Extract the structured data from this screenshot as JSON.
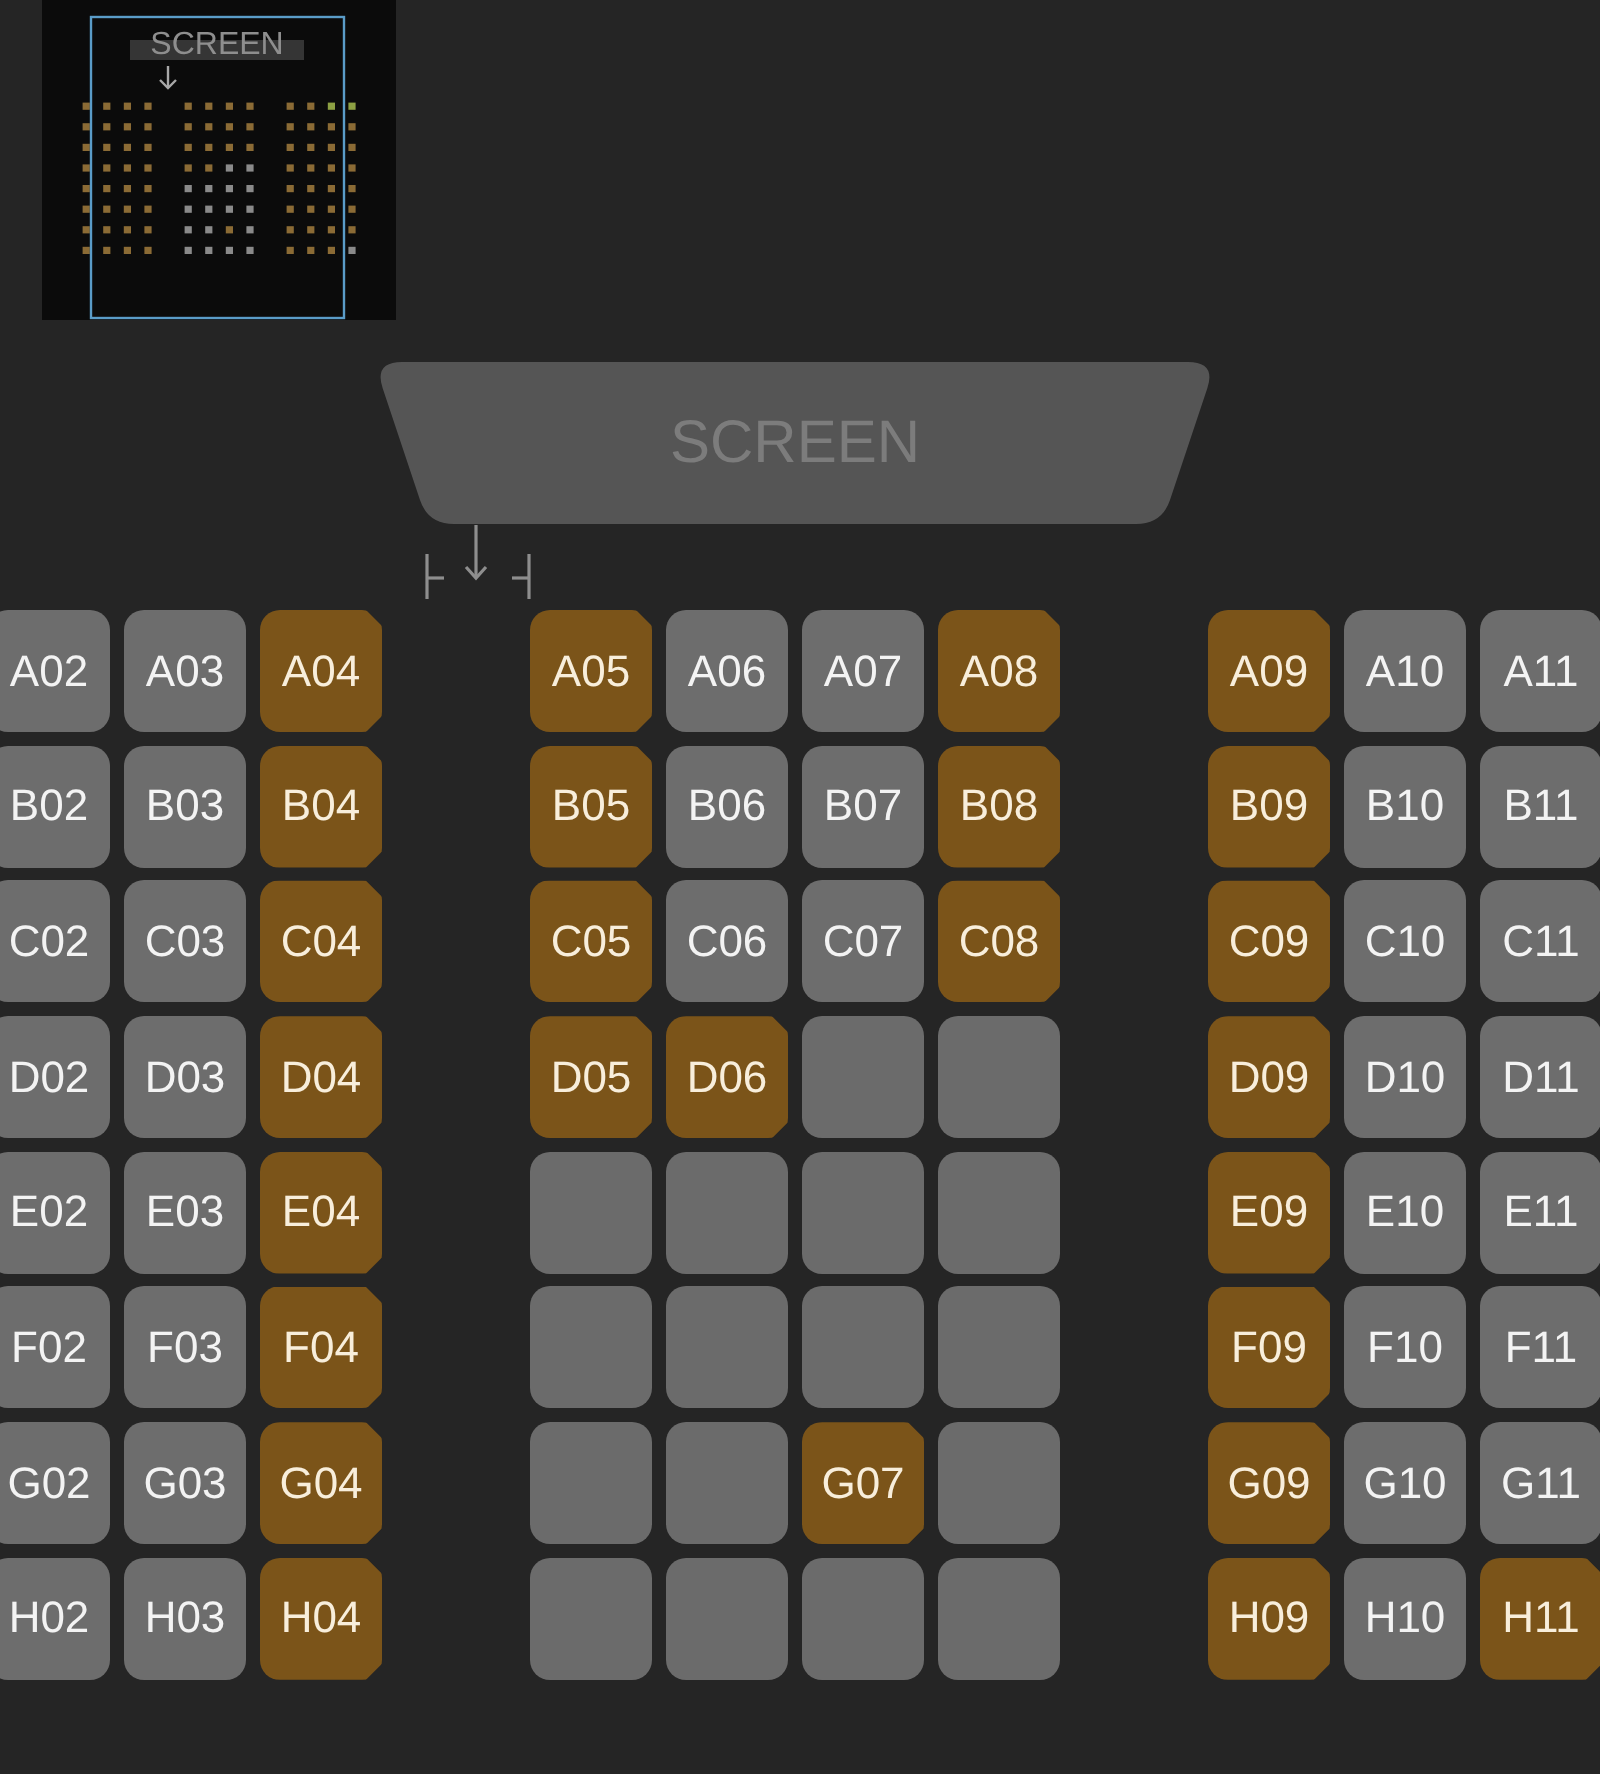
{
  "minimap": {
    "screen_label": "SCREEN",
    "sections": [
      {
        "rows": [
          {
            "dots": [
              {
                "color": "#8b6b35"
              },
              {
                "color": "#8b6b35"
              },
              {
                "color": "#8b6b35"
              },
              {
                "color": "#8b6b35"
              }
            ]
          },
          {
            "dots": [
              {
                "color": "#8b6b35"
              },
              {
                "color": "#8b6b35"
              },
              {
                "color": "#8b6b35"
              },
              {
                "color": "#8b6b35"
              }
            ]
          },
          {
            "dots": [
              {
                "color": "#8b6b35"
              },
              {
                "color": "#8b6b35"
              },
              {
                "color": "#8b6b35"
              },
              {
                "color": "#8b6b35"
              }
            ]
          },
          {
            "dots": [
              {
                "color": "#8b6b35"
              },
              {
                "color": "#8b6b35"
              },
              {
                "color": "#8b6b35"
              },
              {
                "color": "#8b6b35"
              }
            ]
          },
          {
            "dots": [
              {
                "color": "#8b6b35"
              },
              {
                "color": "#8b6b35"
              },
              {
                "color": "#8b6b35"
              },
              {
                "color": "#8b6b35"
              }
            ]
          },
          {
            "dots": [
              {
                "color": "#8b6b35"
              },
              {
                "color": "#8b6b35"
              },
              {
                "color": "#8b6b35"
              },
              {
                "color": "#8b6b35"
              }
            ]
          },
          {
            "dots": [
              {
                "color": "#8b6b35"
              },
              {
                "color": "#8b6b35"
              },
              {
                "color": "#8b6b35"
              },
              {
                "color": "#8b6b35"
              }
            ]
          },
          {
            "dots": [
              {
                "color": "#8b6b35"
              },
              {
                "color": "#8b6b35"
              },
              {
                "color": "#8b6b35"
              },
              {
                "color": "#8b6b35"
              }
            ]
          }
        ]
      },
      {
        "rows": [
          {
            "dots": [
              {
                "color": "#8b6b35"
              },
              {
                "color": "#8b6b35"
              },
              {
                "color": "#8b6b35"
              },
              {
                "color": "#8b6b35"
              }
            ]
          },
          {
            "dots": [
              {
                "color": "#8b6b35"
              },
              {
                "color": "#8b6b35"
              },
              {
                "color": "#8b6b35"
              },
              {
                "color": "#8b6b35"
              }
            ]
          },
          {
            "dots": [
              {
                "color": "#8b6b35"
              },
              {
                "color": "#8b6b35"
              },
              {
                "color": "#8b6b35"
              },
              {
                "color": "#8b6b35"
              }
            ]
          },
          {
            "dots": [
              {
                "color": "#8b6b35"
              },
              {
                "color": "#8b6b35"
              },
              {
                "color": "#8a8a8a"
              },
              {
                "color": "#8a8a8a"
              }
            ]
          },
          {
            "dots": [
              {
                "color": "#8a8a8a"
              },
              {
                "color": "#8a8a8a"
              },
              {
                "color": "#8a8a8a"
              },
              {
                "color": "#8a8a8a"
              }
            ]
          },
          {
            "dots": [
              {
                "color": "#8a8a8a"
              },
              {
                "color": "#8a8a8a"
              },
              {
                "color": "#8a8a8a"
              },
              {
                "color": "#8a8a8a"
              }
            ]
          },
          {
            "dots": [
              {
                "color": "#8a8a8a"
              },
              {
                "color": "#8a8a8a"
              },
              {
                "color": "#8b6b35"
              },
              {
                "color": "#8a8a8a"
              }
            ]
          },
          {
            "dots": [
              {
                "color": "#8a8a8a"
              },
              {
                "color": "#8a8a8a"
              },
              {
                "color": "#8a8a8a"
              },
              {
                "color": "#8a8a8a"
              }
            ]
          }
        ]
      },
      {
        "rows": [
          {
            "dots": [
              {
                "color": "#8b6b35"
              },
              {
                "color": "#8b6b35"
              },
              {
                "color": "#8da043"
              },
              {
                "color": "#8da043"
              }
            ]
          },
          {
            "dots": [
              {
                "color": "#8b6b35"
              },
              {
                "color": "#8b6b35"
              },
              {
                "color": "#8b6b35"
              },
              {
                "color": "#8b6b35"
              }
            ]
          },
          {
            "dots": [
              {
                "color": "#8b6b35"
              },
              {
                "color": "#8b6b35"
              },
              {
                "color": "#8b6b35"
              },
              {
                "color": "#8b6b35"
              }
            ]
          },
          {
            "dots": [
              {
                "color": "#8b6b35"
              },
              {
                "color": "#8b6b35"
              },
              {
                "color": "#8b6b35"
              },
              {
                "color": "#8b6b35"
              }
            ]
          },
          {
            "dots": [
              {
                "color": "#8b6b35"
              },
              {
                "color": "#8b6b35"
              },
              {
                "color": "#8b6b35"
              },
              {
                "color": "#8b6b35"
              }
            ]
          },
          {
            "dots": [
              {
                "color": "#8b6b35"
              },
              {
                "color": "#8b6b35"
              },
              {
                "color": "#8b6b35"
              },
              {
                "color": "#8b6b35"
              }
            ]
          },
          {
            "dots": [
              {
                "color": "#8b6b35"
              },
              {
                "color": "#8b6b35"
              },
              {
                "color": "#8b6b35"
              },
              {
                "color": "#8b6b35"
              }
            ]
          },
          {
            "dots": [
              {
                "color": "#8b6b35"
              },
              {
                "color": "#8b6b35"
              },
              {
                "color": "#8b6b35"
              },
              {
                "color": "#8a8a8a"
              }
            ]
          }
        ]
      }
    ]
  },
  "screen": {
    "label": "SCREEN"
  },
  "seat_sections": [
    {
      "rows": [
        {
          "seats": [
            {
              "label": "A02",
              "kind": "standard"
            },
            {
              "label": "A03",
              "kind": "standard"
            },
            {
              "label": "A04",
              "kind": "special"
            }
          ]
        },
        {
          "seats": [
            {
              "label": "B02",
              "kind": "standard"
            },
            {
              "label": "B03",
              "kind": "standard"
            },
            {
              "label": "B04",
              "kind": "special"
            }
          ]
        },
        {
          "seats": [
            {
              "label": "C02",
              "kind": "standard"
            },
            {
              "label": "C03",
              "kind": "standard"
            },
            {
              "label": "C04",
              "kind": "special"
            }
          ]
        },
        {
          "seats": [
            {
              "label": "D02",
              "kind": "standard"
            },
            {
              "label": "D03",
              "kind": "standard"
            },
            {
              "label": "D04",
              "kind": "special"
            }
          ]
        },
        {
          "seats": [
            {
              "label": "E02",
              "kind": "standard"
            },
            {
              "label": "E03",
              "kind": "standard"
            },
            {
              "label": "E04",
              "kind": "special"
            }
          ]
        },
        {
          "seats": [
            {
              "label": "F02",
              "kind": "standard"
            },
            {
              "label": "F03",
              "kind": "standard"
            },
            {
              "label": "F04",
              "kind": "special"
            }
          ]
        },
        {
          "seats": [
            {
              "label": "G02",
              "kind": "standard"
            },
            {
              "label": "G03",
              "kind": "standard"
            },
            {
              "label": "G04",
              "kind": "special"
            }
          ]
        },
        {
          "seats": [
            {
              "label": "H02",
              "kind": "standard"
            },
            {
              "label": "H03",
              "kind": "standard"
            },
            {
              "label": "H04",
              "kind": "special"
            }
          ]
        }
      ]
    },
    {
      "rows": [
        {
          "seats": [
            {
              "label": "A05",
              "kind": "special"
            },
            {
              "label": "A06",
              "kind": "standard"
            },
            {
              "label": "A07",
              "kind": "standard"
            },
            {
              "label": "A08",
              "kind": "special"
            }
          ]
        },
        {
          "seats": [
            {
              "label": "B05",
              "kind": "special"
            },
            {
              "label": "B06",
              "kind": "standard"
            },
            {
              "label": "B07",
              "kind": "standard"
            },
            {
              "label": "B08",
              "kind": "special"
            }
          ]
        },
        {
          "seats": [
            {
              "label": "C05",
              "kind": "special"
            },
            {
              "label": "C06",
              "kind": "standard"
            },
            {
              "label": "C07",
              "kind": "standard"
            },
            {
              "label": "C08",
              "kind": "special"
            }
          ]
        },
        {
          "seats": [
            {
              "label": "D05",
              "kind": "special"
            },
            {
              "label": "D06",
              "kind": "special"
            },
            {
              "kind": "unavailable"
            },
            {
              "kind": "unavailable"
            }
          ]
        },
        {
          "seats": [
            {
              "kind": "unavailable"
            },
            {
              "kind": "unavailable"
            },
            {
              "kind": "unavailable"
            },
            {
              "kind": "unavailable"
            }
          ]
        },
        {
          "seats": [
            {
              "kind": "unavailable"
            },
            {
              "kind": "unavailable"
            },
            {
              "kind": "unavailable"
            },
            {
              "kind": "unavailable"
            }
          ]
        },
        {
          "seats": [
            {
              "kind": "unavailable"
            },
            {
              "kind": "unavailable"
            },
            {
              "label": "G07",
              "kind": "special"
            },
            {
              "kind": "unavailable"
            }
          ]
        },
        {
          "seats": [
            {
              "kind": "unavailable"
            },
            {
              "kind": "unavailable"
            },
            {
              "kind": "unavailable"
            },
            {
              "kind": "unavailable"
            }
          ]
        }
      ]
    },
    {
      "rows": [
        {
          "seats": [
            {
              "label": "A09",
              "kind": "special"
            },
            {
              "label": "A10",
              "kind": "standard"
            },
            {
              "label": "A11",
              "kind": "standard"
            }
          ]
        },
        {
          "seats": [
            {
              "label": "B09",
              "kind": "special"
            },
            {
              "label": "B10",
              "kind": "standard"
            },
            {
              "label": "B11",
              "kind": "standard"
            }
          ]
        },
        {
          "seats": [
            {
              "label": "C09",
              "kind": "special"
            },
            {
              "label": "C10",
              "kind": "standard"
            },
            {
              "label": "C11",
              "kind": "standard"
            }
          ]
        },
        {
          "seats": [
            {
              "label": "D09",
              "kind": "special"
            },
            {
              "label": "D10",
              "kind": "standard"
            },
            {
              "label": "D11",
              "kind": "standard"
            }
          ]
        },
        {
          "seats": [
            {
              "label": "E09",
              "kind": "special"
            },
            {
              "label": "E10",
              "kind": "standard"
            },
            {
              "label": "E11",
              "kind": "standard"
            }
          ]
        },
        {
          "seats": [
            {
              "label": "F09",
              "kind": "special"
            },
            {
              "label": "F10",
              "kind": "standard"
            },
            {
              "label": "F11",
              "kind": "standard"
            }
          ]
        },
        {
          "seats": [
            {
              "label": "G09",
              "kind": "special"
            },
            {
              "label": "G10",
              "kind": "standard"
            },
            {
              "label": "G11",
              "kind": "standard"
            }
          ]
        },
        {
          "seats": [
            {
              "label": "H09",
              "kind": "special"
            },
            {
              "label": "H10",
              "kind": "standard"
            },
            {
              "label": "H11",
              "kind": "special"
            }
          ]
        }
      ]
    }
  ]
}
